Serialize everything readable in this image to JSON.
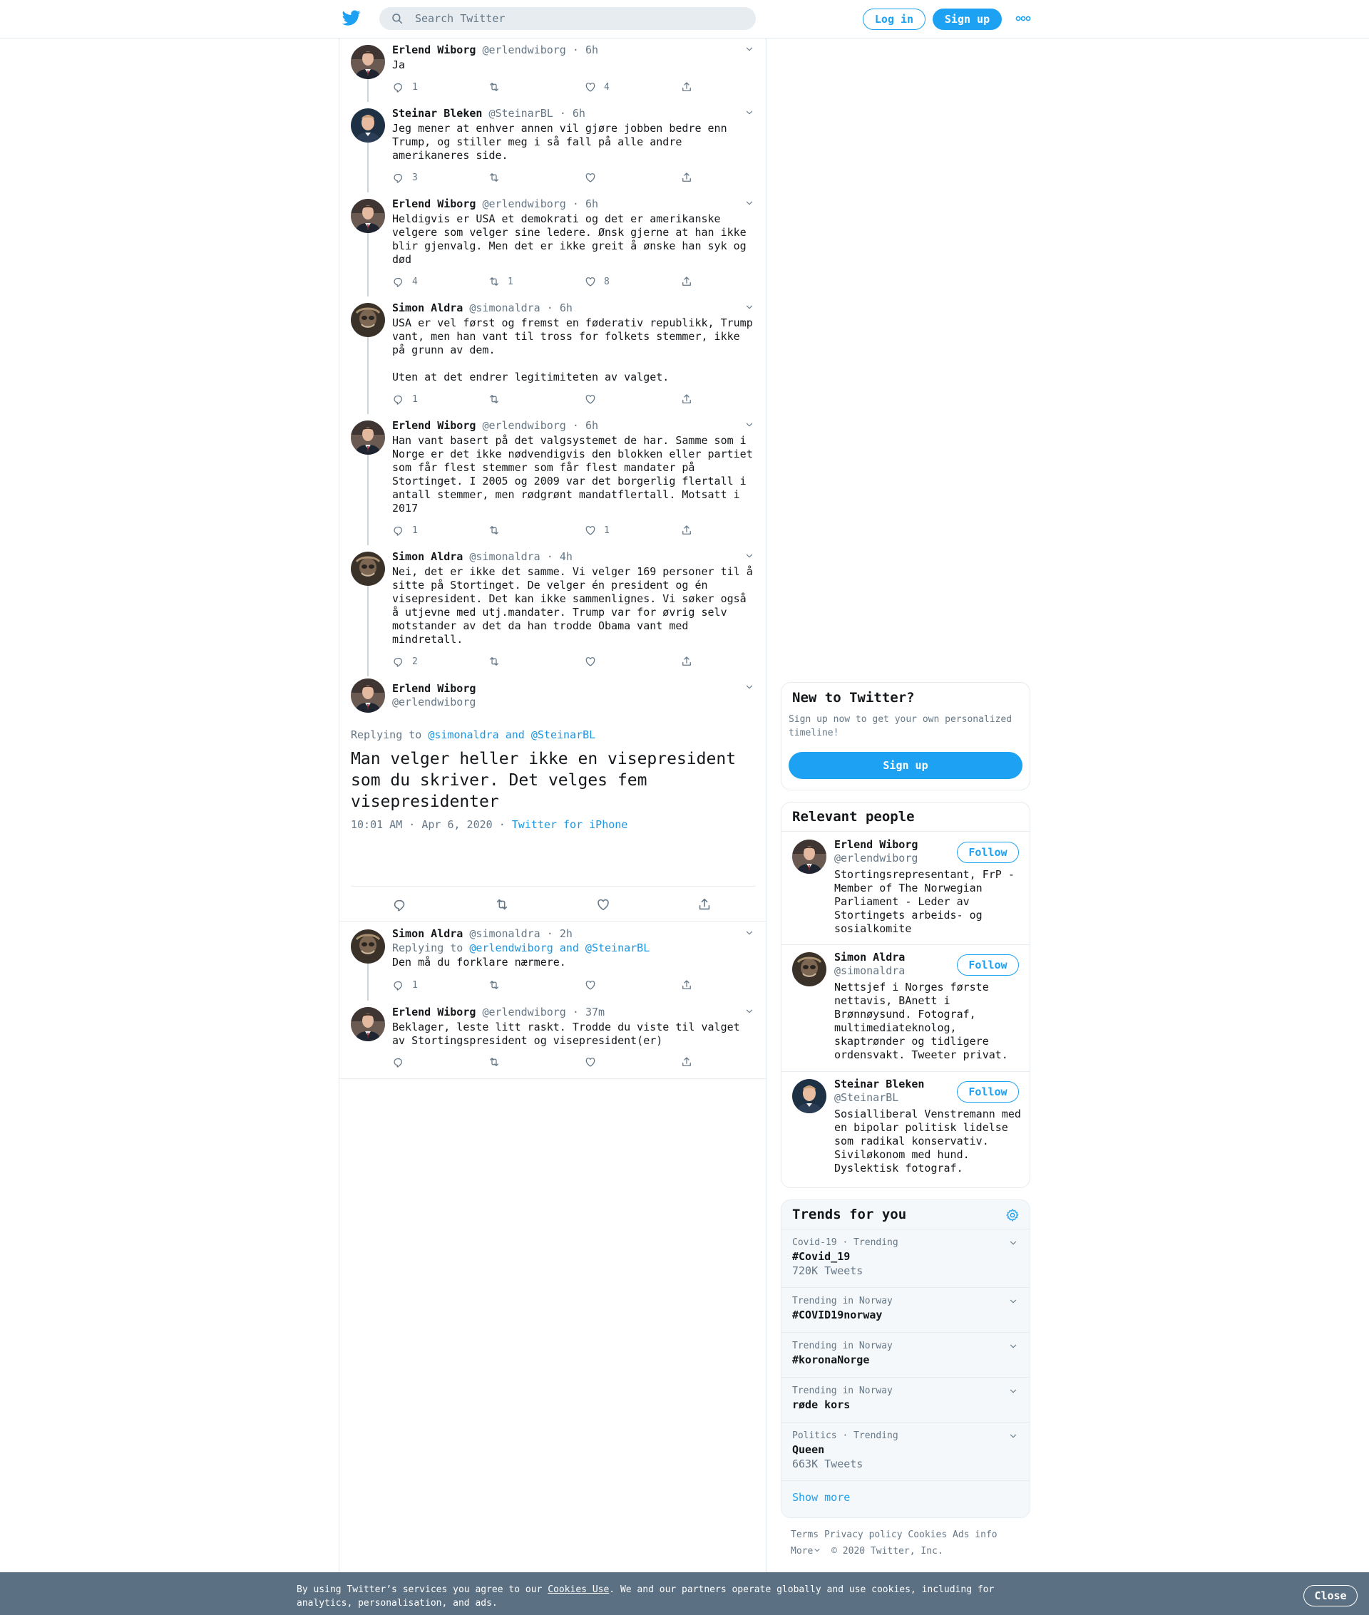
{
  "header": {
    "search_placeholder": "Search Twitter",
    "login_label": "Log in",
    "signup_label": "Sign up"
  },
  "tweets": [
    {
      "name": "Erlend Wiborg",
      "handle": "@erlendwiborg",
      "time": "6h",
      "text": "Ja",
      "replies": "1",
      "retweets": "",
      "likes": "4",
      "avatar": "erlend"
    },
    {
      "name": "Steinar Bleken",
      "handle": "@SteinarBL",
      "time": "6h",
      "text": "Jeg mener at enhver annen vil gjøre jobben bedre enn Trump, og stiller meg i så fall på alle andre amerikaneres side.",
      "replies": "3",
      "retweets": "",
      "likes": "",
      "avatar": "steinar"
    },
    {
      "name": "Erlend Wiborg",
      "handle": "@erlendwiborg",
      "time": "6h",
      "text": "Heldigvis er USA et demokrati og det er amerikanske velgere som velger sine ledere. Ønsk gjerne at han ikke blir gjenvalg. Men det er ikke greit å ønske han syk og død",
      "replies": "4",
      "retweets": "1",
      "likes": "8",
      "avatar": "erlend"
    },
    {
      "name": "Simon Aldra",
      "handle": "@simonaldra",
      "time": "6h",
      "text": "USA er vel først og fremst en føderativ republikk, Trump vant, men han vant til tross for folkets stemmer, ikke på grunn av dem.\n\nUten at det endrer legitimiteten av valget.",
      "replies": "1",
      "retweets": "",
      "likes": "",
      "avatar": "simon"
    },
    {
      "name": "Erlend Wiborg",
      "handle": "@erlendwiborg",
      "time": "6h",
      "text": "Han vant basert på det valgsystemet de har. Samme som i Norge er det ikke nødvendigvis den blokken eller partiet som får flest stemmer som får flest mandater på Stortinget. I 2005 og 2009 var det borgerlig flertall i antall stemmer, men rødgrønt mandatflertall. Motsatt i 2017",
      "replies": "1",
      "retweets": "",
      "likes": "1",
      "avatar": "erlend"
    },
    {
      "name": "Simon Aldra",
      "handle": "@simonaldra",
      "time": "4h",
      "text": "Nei, det er ikke det samme. Vi velger 169 personer til å sitte på Stortinget. De velger én president og én visepresident. Det kan ikke sammenlignes. Vi søker også å utjevne med utj.mandater. Trump var for øvrig selv motstander av det da han trodde Obama vant med mindretall.",
      "replies": "2",
      "retweets": "",
      "likes": "",
      "avatar": "simon"
    }
  ],
  "focus": {
    "name": "Erlend Wiborg",
    "handle": "@erlendwiborg",
    "replying_prefix": "Replying to ",
    "replying_to": "@simonaldra and @SteinarBL",
    "text": "Man velger heller ikke en visepresident som du skriver. Det velges fem visepresidenter",
    "timestamp": "10:01 AM · Apr 6, 2020 · ",
    "source": "Twitter for iPhone"
  },
  "replies": [
    {
      "name": "Simon Aldra",
      "handle": "@simonaldra",
      "time": "2h",
      "replying_prefix": "Replying to ",
      "replying_to": "@erlendwiborg and @SteinarBL",
      "text": "Den må du forklare nærmere.",
      "replies": "1",
      "retweets": "",
      "likes": "",
      "avatar": "simon"
    },
    {
      "name": "Erlend Wiborg",
      "handle": "@erlendwiborg",
      "time": "37m",
      "text": "Beklager, leste litt raskt. Trodde du viste til valget av Stortingspresident og visepresident(er)",
      "replies": "",
      "retweets": "",
      "likes": "",
      "avatar": "erlend"
    }
  ],
  "new_to_twitter": {
    "title": "New to Twitter?",
    "text": "Sign up now to get your own personalized timeline!",
    "button": "Sign up"
  },
  "relevant": {
    "title": "Relevant people",
    "follow_label": "Follow",
    "people": [
      {
        "name": "Erlend Wiborg",
        "handle": "@erlendwiborg",
        "bio": "Stortingsrepresentant, FrP - Member of The Norwegian Parliament - Leder av Stortingets arbeids- og sosialkomite"
      },
      {
        "name": "Simon Aldra",
        "handle": "@simonaldra",
        "bio": "Nettsjef i Norges første nettavis, BAnett i Brønnøysund. Fotograf, multimediateknolog, skaptrønder og tidligere ordensvakt. Tweeter privat."
      },
      {
        "name": "Steinar Bleken",
        "handle": "@SteinarBL",
        "bio": "Sosialliberal Venstremann med en bipolar politisk lidelse som radikal konservativ. Siviløkonom med hund. Dyslektisk fotograf."
      }
    ]
  },
  "trends": {
    "title": "Trends for you",
    "items": [
      {
        "meta": "Covid-19 · Trending",
        "title": "#Covid_19",
        "count": "720K Tweets"
      },
      {
        "meta": "Trending in Norway",
        "title": "#COVID19norway",
        "count": ""
      },
      {
        "meta": "Trending in Norway",
        "title": "#koronaNorge",
        "count": ""
      },
      {
        "meta": "Trending in Norway",
        "title": "røde kors",
        "count": ""
      },
      {
        "meta": "Politics · Trending",
        "title": "Queen",
        "count": "663K Tweets"
      }
    ],
    "show_more": "Show more"
  },
  "footer": {
    "links": [
      "Terms",
      "Privacy policy",
      "Cookies",
      "Ads info"
    ],
    "more": "More",
    "copyright": "© 2020 Twitter, Inc."
  },
  "cookie": {
    "prefix": "By using Twitter’s services you agree to our ",
    "link": "Cookies Use",
    "suffix": ". We and our partners operate globally and use cookies, including for analytics, personalisation, and ads.",
    "close": "Close"
  },
  "colors": {
    "accent": "#1da1f2",
    "link": "#1b95e0",
    "muted": "#657786",
    "banner": "#5b7083"
  }
}
